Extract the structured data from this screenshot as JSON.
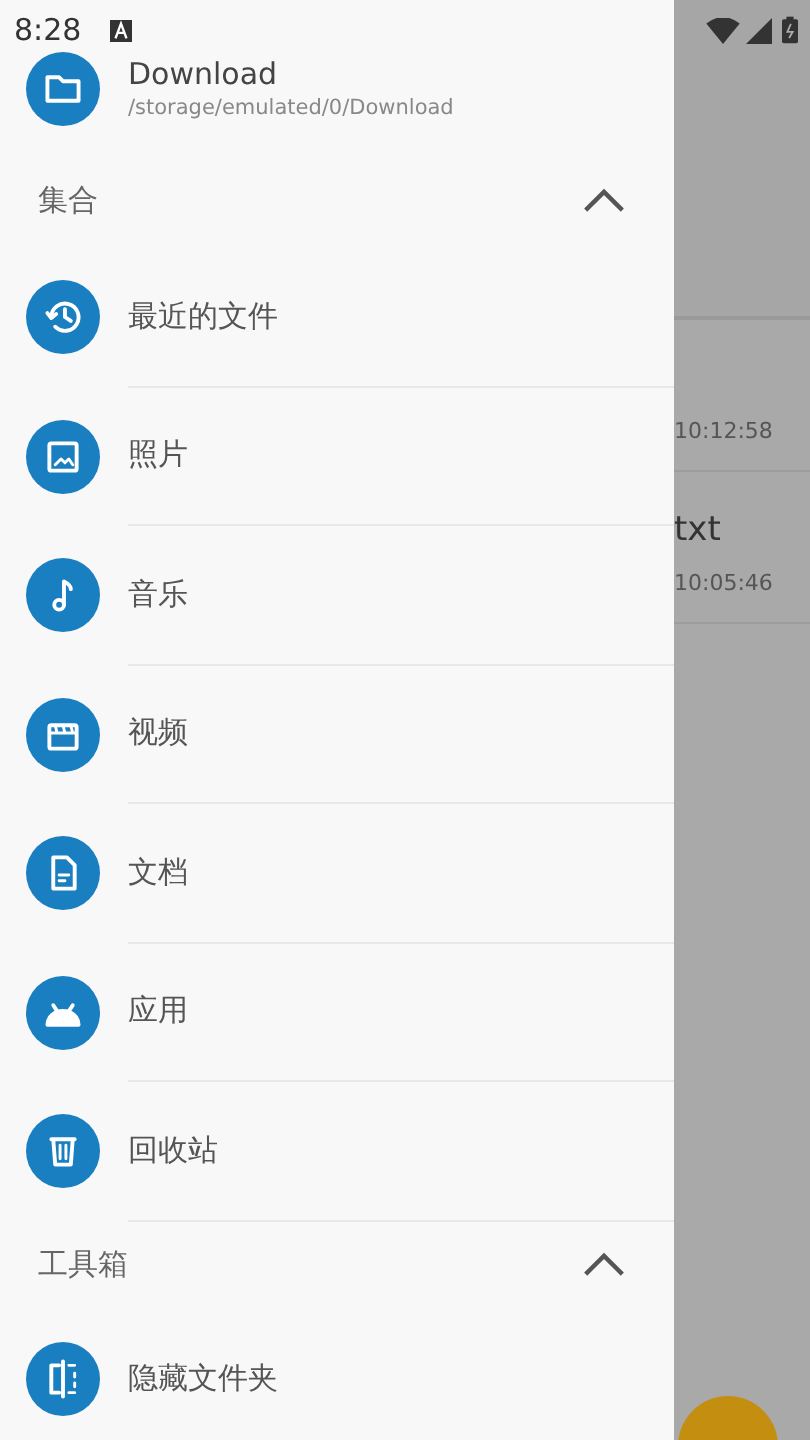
{
  "status_bar": {
    "time": "8:28"
  },
  "drawer": {
    "current_folder": {
      "name": "Download",
      "path": "/storage/emulated/0/Download"
    },
    "sections": [
      {
        "title": "集合",
        "expanded": true,
        "items": [
          {
            "label": "最近的文件",
            "kind": "recent"
          },
          {
            "label": "照片",
            "kind": "photo"
          },
          {
            "label": "音乐",
            "kind": "music"
          },
          {
            "label": "视频",
            "kind": "video"
          },
          {
            "label": "文档",
            "kind": "document"
          },
          {
            "label": "应用",
            "kind": "app"
          },
          {
            "label": "回收站",
            "kind": "trash"
          }
        ]
      },
      {
        "title": "工具箱",
        "expanded": true,
        "items": [
          {
            "label": "隐藏文件夹",
            "kind": "hidden"
          }
        ]
      }
    ]
  },
  "background": {
    "rows": [
      {
        "time": "10:12:58"
      },
      {
        "title": "txt",
        "time": "10:05:46"
      }
    ]
  }
}
